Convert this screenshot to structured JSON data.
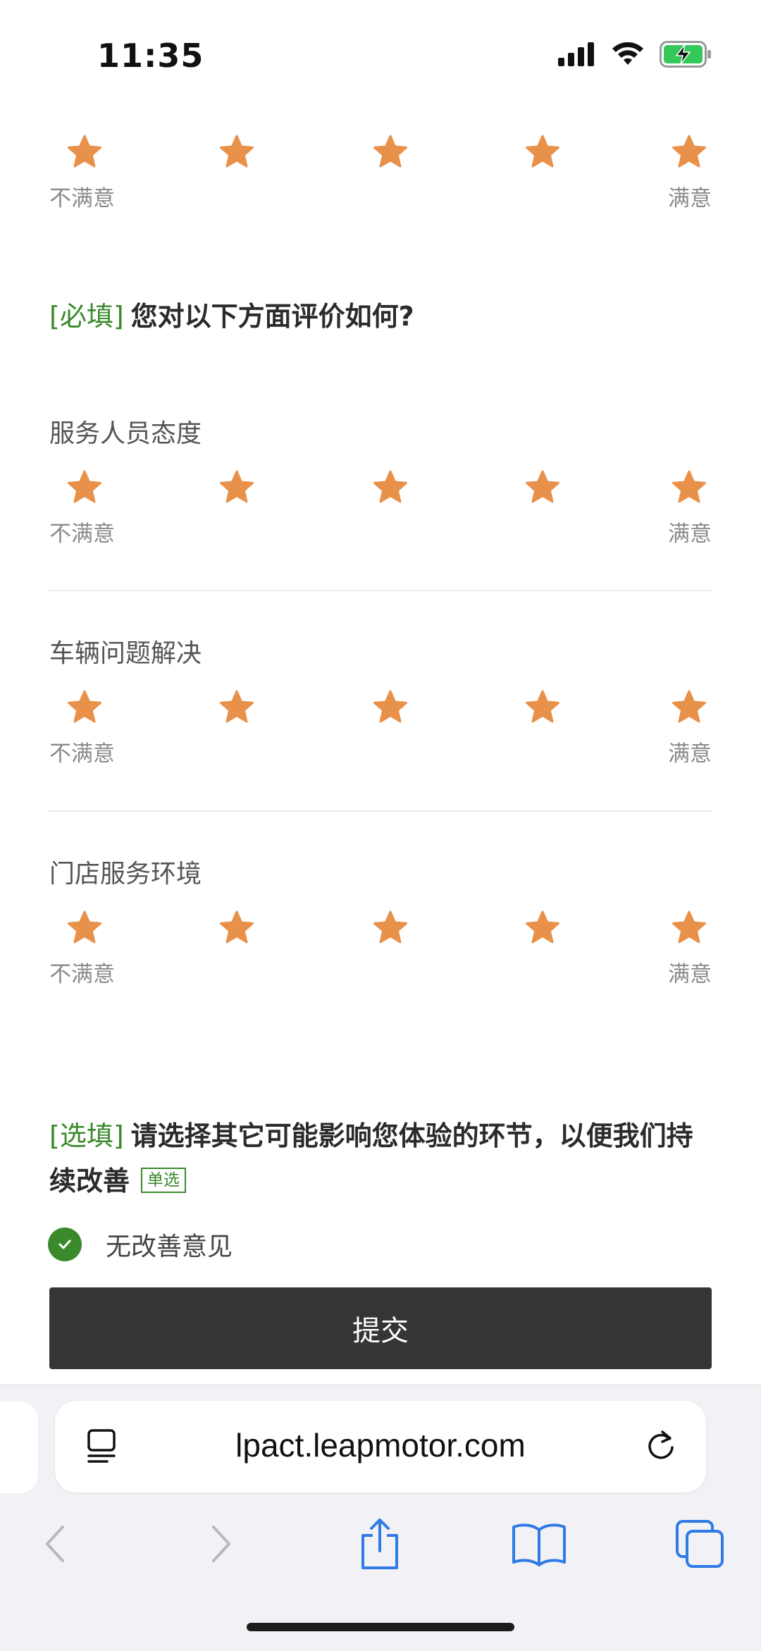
{
  "status_bar": {
    "time": "11:35"
  },
  "top_rating": {
    "low_label": "不满意",
    "high_label": "满意",
    "stars": 5
  },
  "question1": {
    "tag": "[必填]",
    "text": "您对以下方面评价如何?",
    "items": [
      {
        "title": "服务人员态度",
        "low_label": "不满意",
        "high_label": "满意",
        "rating": 5
      },
      {
        "title": "车辆问题解决",
        "low_label": "不满意",
        "high_label": "满意",
        "rating": 5
      },
      {
        "title": "门店服务环境",
        "low_label": "不满意",
        "high_label": "满意",
        "rating": 5
      }
    ]
  },
  "question2": {
    "tag": "[选填]",
    "text": "请选择其它可能影响您体验的环节，以便我们持续改善",
    "badge": "单选",
    "option": {
      "label": "无改善意见",
      "selected": true
    }
  },
  "submit_label": "提交",
  "browser": {
    "url": "lpact.leapmotor.com"
  },
  "colors": {
    "star": "#e8914a",
    "accent_green": "#3a8a2c",
    "button_dark": "#353535"
  }
}
